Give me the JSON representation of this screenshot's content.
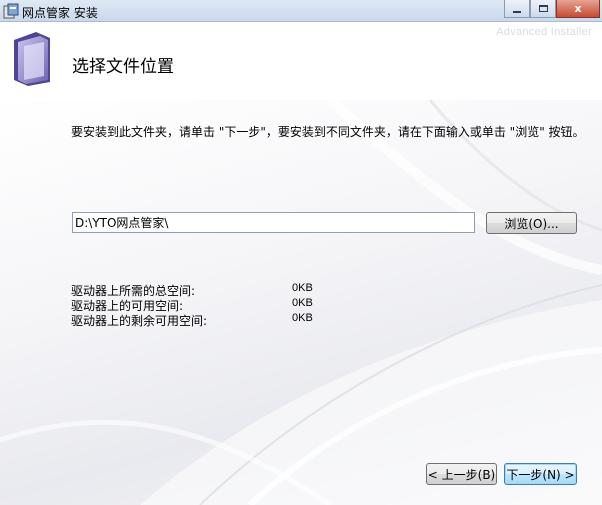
{
  "window": {
    "title": "网点管家 安装",
    "minimize_label": "",
    "maximize_label": "",
    "close_label": "x"
  },
  "header": {
    "title": "选择文件位置",
    "brand": "Advanced Installer"
  },
  "body": {
    "instruction": "要安装到此文件夹，请单击 \"下一步\"，要安装到不同文件夹，请在下面输入或单击 \"浏览\" 按钮。",
    "path_value": "D:\\YTO网点管家\\",
    "browse_label": "浏览(O)...",
    "space": [
      {
        "label": "驱动器上所需的总空间:",
        "value": "0KB"
      },
      {
        "label": "驱动器上的可用空间:",
        "value": "0KB"
      },
      {
        "label": "驱动器上的剩余可用空间:",
        "value": "0KB"
      }
    ]
  },
  "footer": {
    "back_label": "< 上一步(B)",
    "next_label": "下一步(N) >"
  },
  "colors": {
    "title_bar": "#c9d8ec",
    "button_default": "#a7d9f5",
    "close_button": "#c74a33"
  },
  "icons": {
    "app": "installer-app-icon",
    "header": "folder-icon"
  }
}
